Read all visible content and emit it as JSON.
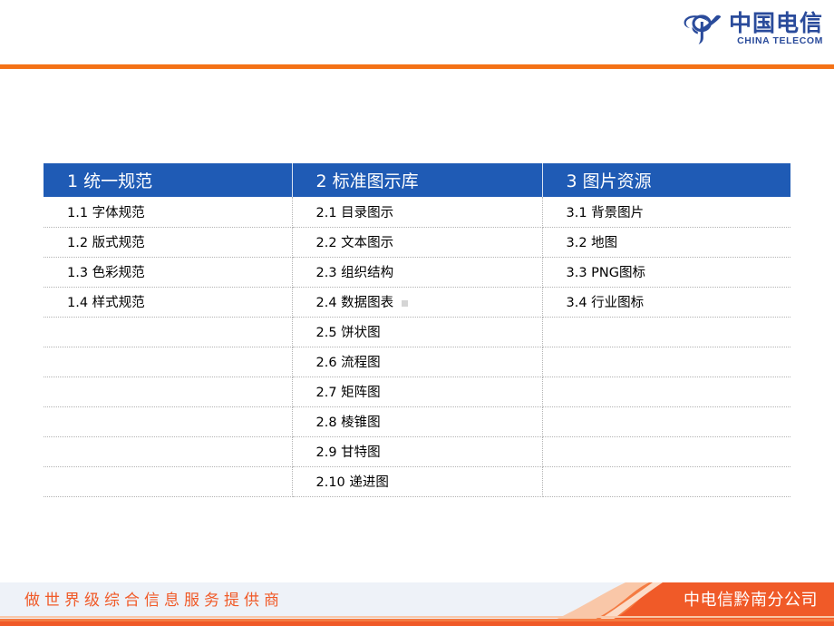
{
  "header": {
    "logo": {
      "icon_name": "china-telecom-logo",
      "chinese_name": "中国电信",
      "english_name": "CHINA TELECOM"
    },
    "rule_color": "#f47216"
  },
  "table": {
    "header_color": "#1f5bb5",
    "columns": [
      {
        "title": "1 统一规范"
      },
      {
        "title": "2 标准图示库"
      },
      {
        "title": "3 图片资源"
      }
    ],
    "rows": [
      {
        "c1": "1.1 字体规范",
        "c2": "2.1 目录图示",
        "c3": "3.1 背景图片"
      },
      {
        "c1": "1.2 版式规范",
        "c2": "2.2 文本图示",
        "c3": "3.2 地图"
      },
      {
        "c1": "1.3 色彩规范",
        "c2": "2.3 组织结构",
        "c3": "3.3 PNG图标"
      },
      {
        "c1": "1.4 样式规范",
        "c2": "2.4 数据图表",
        "c3": "3.4 行业图标"
      },
      {
        "c1": "",
        "c2": "2.5 饼状图",
        "c3": ""
      },
      {
        "c1": "",
        "c2": "2.6 流程图",
        "c3": ""
      },
      {
        "c1": "",
        "c2": "2.7 矩阵图",
        "c3": ""
      },
      {
        "c1": "",
        "c2": "2.8 棱锥图",
        "c3": ""
      },
      {
        "c1": "",
        "c2": "2.9 甘特图",
        "c3": ""
      },
      {
        "c1": "",
        "c2": "2.10 递进图",
        "c3": ""
      }
    ]
  },
  "footer": {
    "slogan": "做世界级综合信息服务提供商",
    "company": "中电信黔南分公司",
    "band_color": "#f05a28",
    "band_bg": "#eef2f8"
  }
}
